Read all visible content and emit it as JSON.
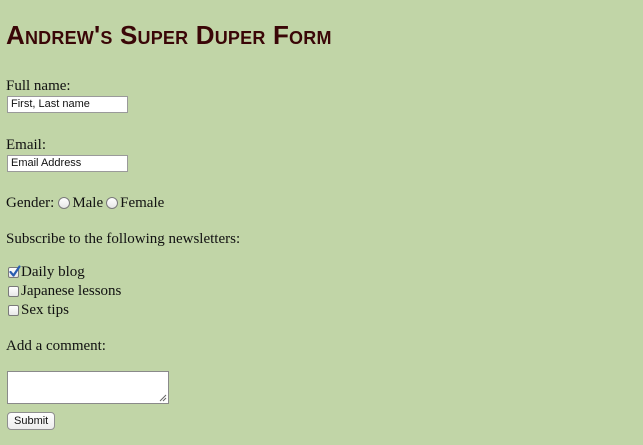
{
  "form": {
    "title": "Andrew's Super Duper Form",
    "full_name": {
      "label": "Full name:",
      "value": "First, Last name"
    },
    "email": {
      "label": "Email:",
      "value": "Email Address"
    },
    "gender": {
      "label": "Gender:",
      "options": [
        {
          "label": "Male",
          "checked": false
        },
        {
          "label": "Female",
          "checked": false
        }
      ]
    },
    "newsletters": {
      "label": "Subscribe to the following newsletters:",
      "options": [
        {
          "label": "Daily blog",
          "checked": true
        },
        {
          "label": "Japanese lessons",
          "checked": false
        },
        {
          "label": "Sex tips",
          "checked": false
        }
      ]
    },
    "comment": {
      "label": "Add a comment:",
      "value": ""
    },
    "submit_label": "Submit"
  },
  "colors": {
    "background": "#c1d5a7",
    "title": "#3a0607",
    "checkmark": "#2a5db0"
  }
}
